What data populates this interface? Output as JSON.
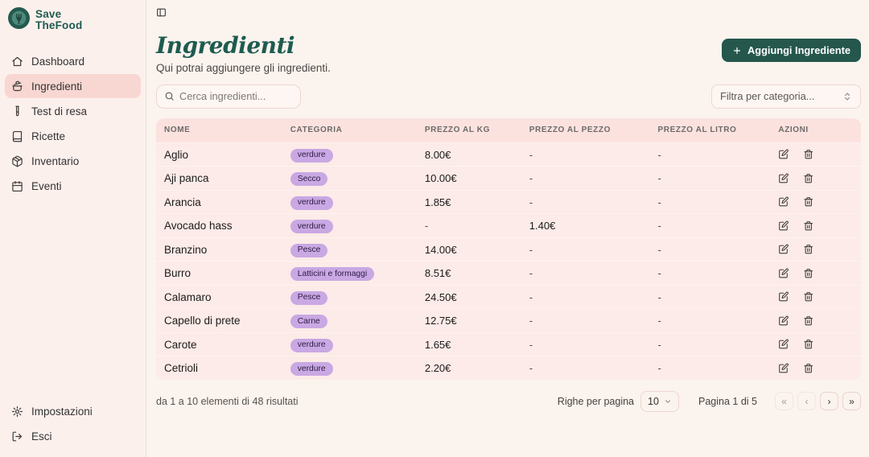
{
  "brand": {
    "line1": "Save",
    "line2": "TheFood"
  },
  "sidebar": {
    "items": [
      {
        "label": "Dashboard",
        "icon": "home-icon",
        "active": false
      },
      {
        "label": "Ingredienti",
        "icon": "pot-icon",
        "active": true
      },
      {
        "label": "Test di resa",
        "icon": "test-tube-icon",
        "active": false
      },
      {
        "label": "Ricette",
        "icon": "book-icon",
        "active": false
      },
      {
        "label": "Inventario",
        "icon": "package-icon",
        "active": false
      },
      {
        "label": "Eventi",
        "icon": "calendar-icon",
        "active": false
      }
    ],
    "footer_items": [
      {
        "label": "Impostazioni",
        "icon": "gear-icon"
      },
      {
        "label": "Esci",
        "icon": "logout-icon"
      }
    ]
  },
  "header": {
    "title": "Ingredienti",
    "subtitle": "Qui potrai aggiungere gli ingredienti.",
    "add_button_label": "Aggiungi Ingrediente"
  },
  "controls": {
    "search_placeholder": "Cerca ingredienti...",
    "filter_placeholder": "Filtra per categoria..."
  },
  "table": {
    "columns": [
      "NOME",
      "CATEGORIA",
      "PREZZO AL KG",
      "PREZZO AL PEZZO",
      "PREZZO AL LITRO",
      "AZIONI"
    ],
    "rows": [
      {
        "nome": "Aglio",
        "categoria": "verdure",
        "prezzo_kg": "8.00€",
        "prezzo_pezzo": "-",
        "prezzo_litro": "-"
      },
      {
        "nome": "Aji panca",
        "categoria": "Secco",
        "prezzo_kg": "10.00€",
        "prezzo_pezzo": "-",
        "prezzo_litro": "-"
      },
      {
        "nome": "Arancia",
        "categoria": "verdure",
        "prezzo_kg": "1.85€",
        "prezzo_pezzo": "-",
        "prezzo_litro": "-"
      },
      {
        "nome": "Avocado hass",
        "categoria": "verdure",
        "prezzo_kg": "-",
        "prezzo_pezzo": "1.40€",
        "prezzo_litro": "-"
      },
      {
        "nome": "Branzino",
        "categoria": "Pesce",
        "prezzo_kg": "14.00€",
        "prezzo_pezzo": "-",
        "prezzo_litro": "-"
      },
      {
        "nome": "Burro",
        "categoria": "Latticini e formaggi",
        "prezzo_kg": "8.51€",
        "prezzo_pezzo": "-",
        "prezzo_litro": "-"
      },
      {
        "nome": "Calamaro",
        "categoria": "Pesce",
        "prezzo_kg": "24.50€",
        "prezzo_pezzo": "-",
        "prezzo_litro": "-"
      },
      {
        "nome": "Capello di prete",
        "categoria": "Carne",
        "prezzo_kg": "12.75€",
        "prezzo_pezzo": "-",
        "prezzo_litro": "-"
      },
      {
        "nome": "Carote",
        "categoria": "verdure",
        "prezzo_kg": "1.65€",
        "prezzo_pezzo": "-",
        "prezzo_litro": "-"
      },
      {
        "nome": "Cetrioli",
        "categoria": "verdure",
        "prezzo_kg": "2.20€",
        "prezzo_pezzo": "-",
        "prezzo_litro": "-"
      }
    ],
    "row_action_icons": [
      "edit-icon",
      "trash-icon"
    ]
  },
  "pagination": {
    "summary": "da 1 a 10 elementi di 48 risultati",
    "rows_per_page_label": "Righe per pagina",
    "rows_per_page_value": "10",
    "page_label": "Pagina 1 di 5",
    "buttons": [
      {
        "glyph": "«",
        "name": "first-page-button",
        "enabled": false
      },
      {
        "glyph": "‹",
        "name": "previous-page-button",
        "enabled": false
      },
      {
        "glyph": "›",
        "name": "next-page-button",
        "enabled": true
      },
      {
        "glyph": "»",
        "name": "last-page-button",
        "enabled": true
      }
    ]
  },
  "icons": {
    "search-icon": "magnifier",
    "plus-icon": "+",
    "panel-toggle-icon": "sidebar panel",
    "chevrons-up-down-icon": "select arrows",
    "chevron-down-icon": "v",
    "edit-icon": "pencil in square",
    "trash-icon": "trash can"
  },
  "colors": {
    "accent_teal": "#25574c",
    "title_teal": "#1e5b4f",
    "badge_purple": "#c9a8e3",
    "sidebar_pink": "#fcf0ed",
    "active_item_pink": "#f8d7d2",
    "table_header_pink": "#fbe2df",
    "table_row_pink": "#fcebe8",
    "main_background": "#fbf3ee"
  }
}
